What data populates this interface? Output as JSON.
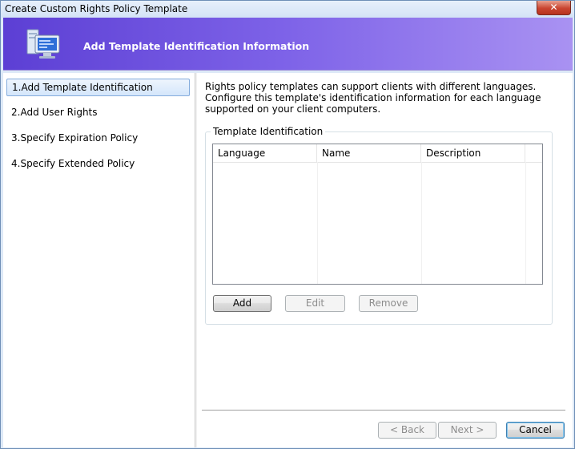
{
  "window": {
    "title": "Create Custom Rights Policy Template",
    "close_label": "✕"
  },
  "banner": {
    "title": "Add Template Identification Information",
    "icon": "computer-monitor-icon"
  },
  "nav": {
    "items": [
      {
        "label": "1.Add Template Identification",
        "selected": true
      },
      {
        "label": "2.Add User Rights",
        "selected": false
      },
      {
        "label": "3.Specify Expiration Policy",
        "selected": false
      },
      {
        "label": "4.Specify Extended Policy",
        "selected": false
      }
    ]
  },
  "main": {
    "description": "Rights policy templates can support clients with different languages. Configure this template's identification information for each language supported on your client computers.",
    "group_label": "Template Identification",
    "columns": [
      "Language",
      "Name",
      "Description"
    ],
    "rows": [],
    "buttons": {
      "add": "Add",
      "edit": "Edit",
      "remove": "Remove"
    }
  },
  "footer": {
    "back": "< Back",
    "next": "Next >",
    "cancel": "Cancel"
  },
  "colors": {
    "banner_start": "#5c3fd4",
    "banner_end": "#a992f2",
    "selection_border": "#84acdd"
  }
}
